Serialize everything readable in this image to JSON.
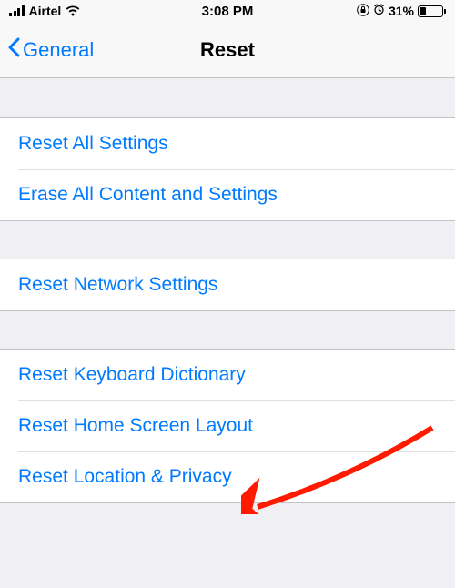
{
  "statusBar": {
    "carrier": "Airtel",
    "time": "3:08 PM",
    "batteryPercent": "31%"
  },
  "nav": {
    "backLabel": "General",
    "title": "Reset"
  },
  "group1": {
    "items": [
      {
        "label": "Reset All Settings"
      },
      {
        "label": "Erase All Content and Settings"
      }
    ]
  },
  "group2": {
    "items": [
      {
        "label": "Reset Network Settings"
      }
    ]
  },
  "group3": {
    "items": [
      {
        "label": "Reset Keyboard Dictionary"
      },
      {
        "label": "Reset Home Screen Layout"
      },
      {
        "label": "Reset Location & Privacy"
      }
    ]
  }
}
